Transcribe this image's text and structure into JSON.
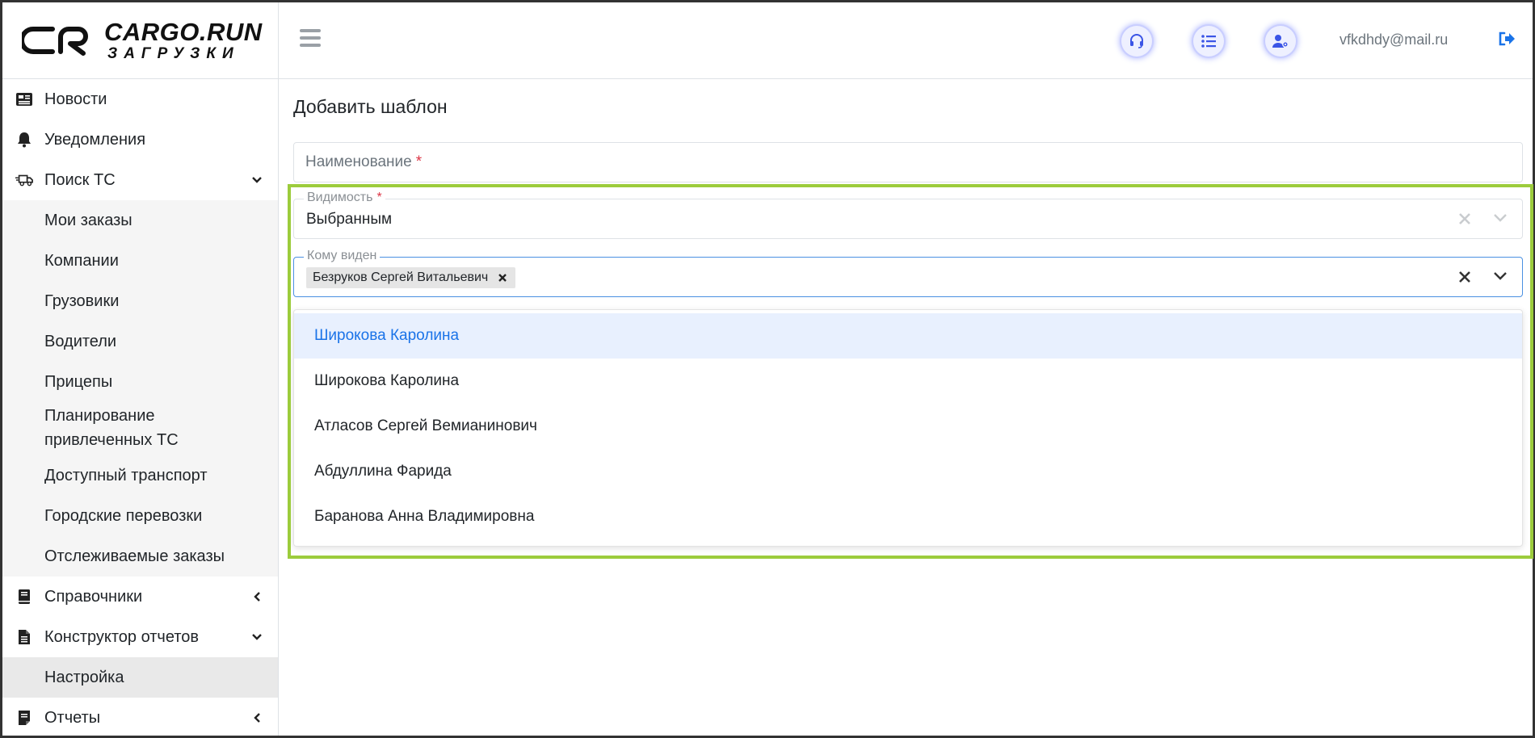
{
  "brand": {
    "title": "CARGO.RUN",
    "subtitle": "ЗАГРУЗКИ"
  },
  "sidebar": {
    "items": [
      {
        "label": "Новости",
        "icon": "newspaper-icon"
      },
      {
        "label": "Уведомления",
        "icon": "bell-icon"
      },
      {
        "label": "Поиск ТС",
        "icon": "truck-icon",
        "expanded": true
      },
      {
        "label": "Справочники",
        "icon": "book-icon",
        "expanded": false
      },
      {
        "label": "Конструктор отчетов",
        "icon": "file-icon",
        "expanded": true
      },
      {
        "label": "Отчеты",
        "icon": "report-icon",
        "expanded": false
      }
    ],
    "search_sub": [
      "Мои заказы",
      "Компании",
      "Грузовики",
      "Водители",
      "Прицепы",
      "Планирование привлеченных ТС",
      "Доступный транспорт",
      "Городские перевозки",
      "Отслеживаемые заказы"
    ],
    "report_sub": [
      "Настройка"
    ]
  },
  "header": {
    "email": "vfkdhdy@mail.ru",
    "icons": [
      "headset-icon",
      "list-icon",
      "user-settings-icon"
    ]
  },
  "form": {
    "title": "Добавить шаблон",
    "name_placeholder": "Наименование",
    "required_mark": "*",
    "visibility": {
      "label": "Видимость",
      "value": "Выбранным"
    },
    "visible_to": {
      "label": "Кому виден",
      "chips": [
        "Безруков Сергей Витальевич"
      ]
    },
    "options": [
      "Широкова Каролина",
      "Широкова Каролина",
      "Атласов Сергей Вемианинович",
      "Абдуллина Фарида",
      "Баранова Анна Владимировна"
    ],
    "highlight_color": "#1a73e8",
    "frame_color": "#9ccc3c"
  }
}
